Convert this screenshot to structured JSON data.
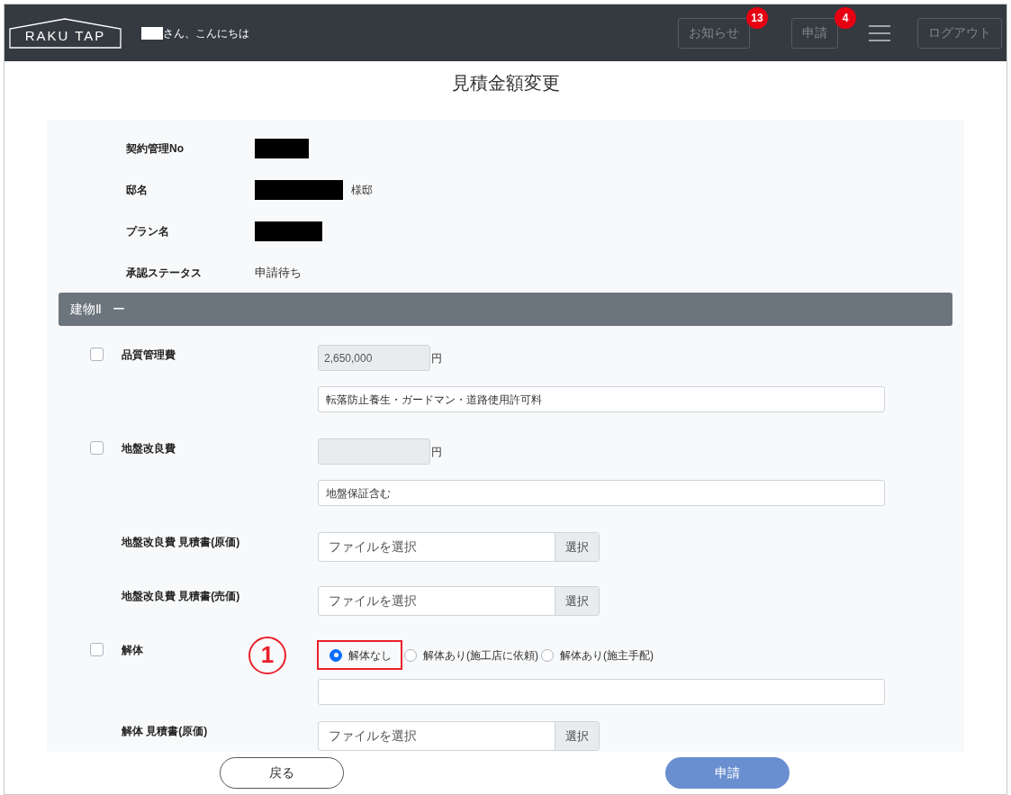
{
  "header": {
    "logo": "RAKU TAP",
    "greeting": "さん、こんにちは",
    "nav": [
      {
        "label": "お知らせ",
        "badge": "13"
      },
      {
        "label": "申請",
        "badge": "4"
      }
    ],
    "logout": "ログアウト"
  },
  "title": "見積金額変更",
  "info": [
    {
      "label": "契約管理No",
      "kind": "redacted"
    },
    {
      "label": "邸名",
      "kind": "redacted",
      "suffix": "様邸"
    },
    {
      "label": "プラン名",
      "kind": "redacted"
    },
    {
      "label": "承認ステータス",
      "kind": "text",
      "value": "申請待ち"
    }
  ],
  "section": {
    "title": "建物Ⅱ",
    "toggle": "ー"
  },
  "items": [
    {
      "kind": "amount",
      "label": "品質管理費",
      "checked": false,
      "amount": "2,650,000",
      "unit": "円",
      "note": "転落防止養生・ガードマン・道路使用許可料"
    },
    {
      "kind": "amount",
      "label": "地盤改良費",
      "checked": false,
      "unit": "円",
      "note": "地盤保証含む"
    },
    {
      "kind": "file",
      "label": "地盤改良費 見積書(原価)",
      "placeholder": "ファイルを選択",
      "button": "選択"
    },
    {
      "kind": "file",
      "label": "地盤改良費 見積書(売価)",
      "placeholder": "ファイルを選択",
      "button": "選択"
    },
    {
      "kind": "radio",
      "label": "解体",
      "checked": false,
      "annotation": "1",
      "options": [
        {
          "label": "解体なし",
          "selected": true,
          "highlighted": true
        },
        {
          "label": "解体あり(施工店に依頼)",
          "selected": false,
          "highlighted": false
        },
        {
          "label": "解体あり(施主手配)",
          "selected": false,
          "highlighted": false
        }
      ]
    },
    {
      "kind": "file",
      "label": "解体 見積書(原価)",
      "placeholder": "ファイルを選択",
      "button": "選択"
    }
  ],
  "footer": {
    "back": "戻る",
    "submit": "申請"
  }
}
